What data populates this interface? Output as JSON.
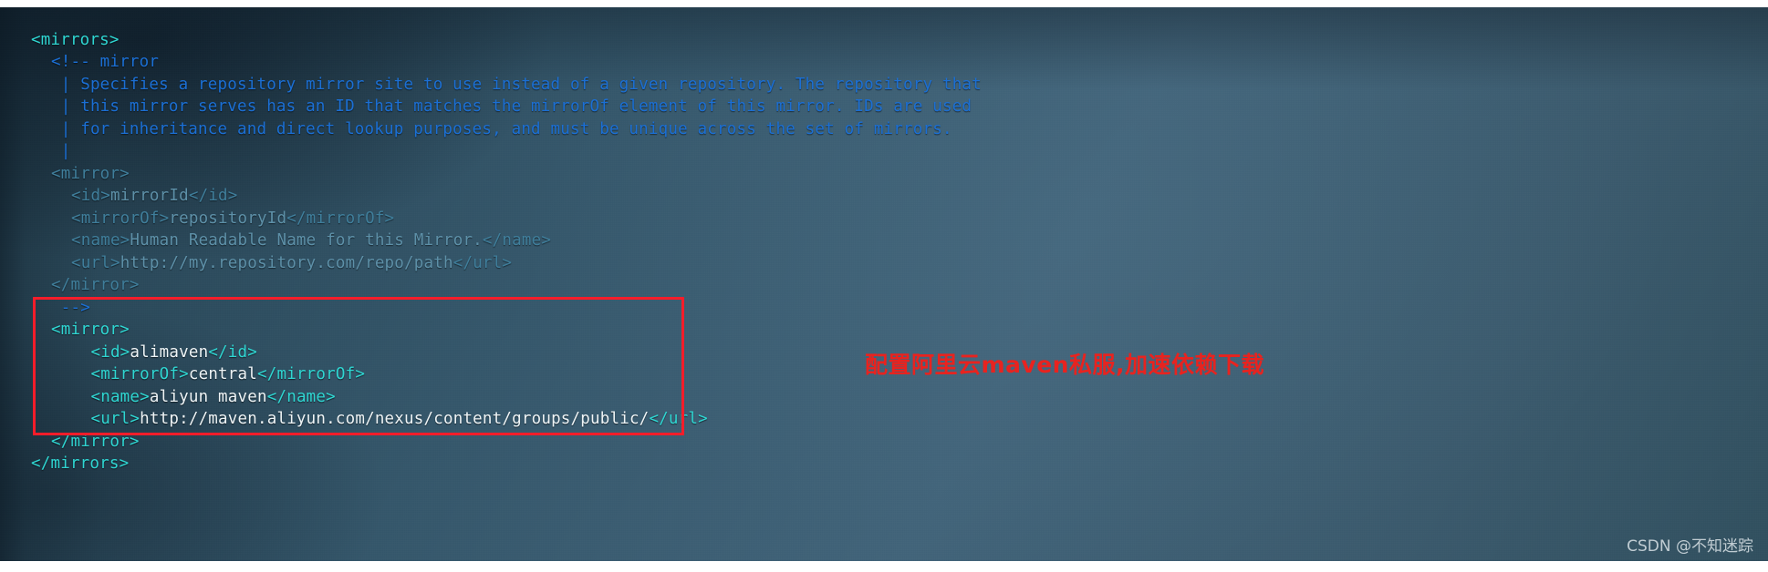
{
  "editor": {
    "file_kind": "maven-settings-xml",
    "colors": {
      "background": "#3d5a6e",
      "tag": "#2fd6d2",
      "text": "#eef4f6",
      "comment": "#1b6fd4",
      "comment_muted": "#5d90a8",
      "highlight_box": "#f51d2a",
      "annotation": "#e8231f"
    },
    "lines": [
      {
        "indent": 0,
        "spans": [
          {
            "c": "tag",
            "t": "<mirrors>"
          }
        ]
      },
      {
        "indent": 1,
        "spans": [
          {
            "c": "cmt",
            "t": "<!-- mirror"
          }
        ]
      },
      {
        "indent": 1,
        "spans": [
          {
            "c": "cmt",
            "t": " | Specifies a repository mirror site to use instead of a given repository. The repository that"
          }
        ]
      },
      {
        "indent": 1,
        "spans": [
          {
            "c": "cmt",
            "t": " | this mirror serves has an ID that matches the mirrorOf element of this mirror. IDs are used"
          }
        ]
      },
      {
        "indent": 1,
        "spans": [
          {
            "c": "cmt",
            "t": " | for inheritance and direct lookup purposes, and must be unique across the set of mirrors."
          }
        ]
      },
      {
        "indent": 1,
        "spans": [
          {
            "c": "cmt",
            "t": " |"
          }
        ]
      },
      {
        "indent": 1,
        "spans": [
          {
            "c": "cmt-tag",
            "t": "<mirror>"
          }
        ]
      },
      {
        "indent": 2,
        "spans": [
          {
            "c": "cmt-tag",
            "t": "<id>"
          },
          {
            "c": "cmt-txt",
            "t": "mirrorId"
          },
          {
            "c": "cmt-tag",
            "t": "</id>"
          }
        ]
      },
      {
        "indent": 2,
        "spans": [
          {
            "c": "cmt-tag",
            "t": "<mirrorOf>"
          },
          {
            "c": "cmt-txt",
            "t": "repositoryId"
          },
          {
            "c": "cmt-tag",
            "t": "</mirrorOf>"
          }
        ]
      },
      {
        "indent": 2,
        "spans": [
          {
            "c": "cmt-tag",
            "t": "<name>"
          },
          {
            "c": "cmt-txt",
            "t": "Human Readable Name for this Mirror."
          },
          {
            "c": "cmt-tag",
            "t": "</name>"
          }
        ]
      },
      {
        "indent": 2,
        "spans": [
          {
            "c": "cmt-tag",
            "t": "<url>"
          },
          {
            "c": "cmt-txt",
            "t": "http://my.repository.com/repo/path"
          },
          {
            "c": "cmt-tag",
            "t": "</url>"
          }
        ]
      },
      {
        "indent": 1,
        "spans": [
          {
            "c": "cmt-tag",
            "t": "</mirror>"
          }
        ]
      },
      {
        "indent": 1,
        "spans": [
          {
            "c": "cmt",
            "t": " -->"
          }
        ]
      },
      {
        "indent": 1,
        "spans": [
          {
            "c": "tag",
            "t": "<mirror>"
          }
        ]
      },
      {
        "indent": 2,
        "spans": [
          {
            "c": "tag",
            "t": "  <id>"
          },
          {
            "c": "txt",
            "t": "alimaven"
          },
          {
            "c": "tag",
            "t": "</id>"
          }
        ]
      },
      {
        "indent": 2,
        "spans": [
          {
            "c": "tag",
            "t": "  <mirrorOf>"
          },
          {
            "c": "txt",
            "t": "central"
          },
          {
            "c": "tag",
            "t": "</mirrorOf>"
          }
        ]
      },
      {
        "indent": 2,
        "spans": [
          {
            "c": "tag",
            "t": "  <name>"
          },
          {
            "c": "txt",
            "t": "aliyun maven"
          },
          {
            "c": "tag",
            "t": "</name>"
          }
        ]
      },
      {
        "indent": 2,
        "spans": [
          {
            "c": "tag",
            "t": "  <url>"
          },
          {
            "c": "txt",
            "t": "http://maven.aliyun.com/nexus/content/groups/public/"
          },
          {
            "c": "tag",
            "t": "</url>"
          }
        ]
      },
      {
        "indent": 1,
        "spans": [
          {
            "c": "tag",
            "t": "</mirror>"
          }
        ]
      },
      {
        "indent": 0,
        "spans": [
          {
            "c": "tag",
            "t": "</mirrors>"
          }
        ]
      }
    ]
  },
  "annotation": {
    "text": "配置阿里云maven私服,加速依赖下载"
  },
  "watermark": {
    "text": "CSDN @不知迷踪"
  }
}
